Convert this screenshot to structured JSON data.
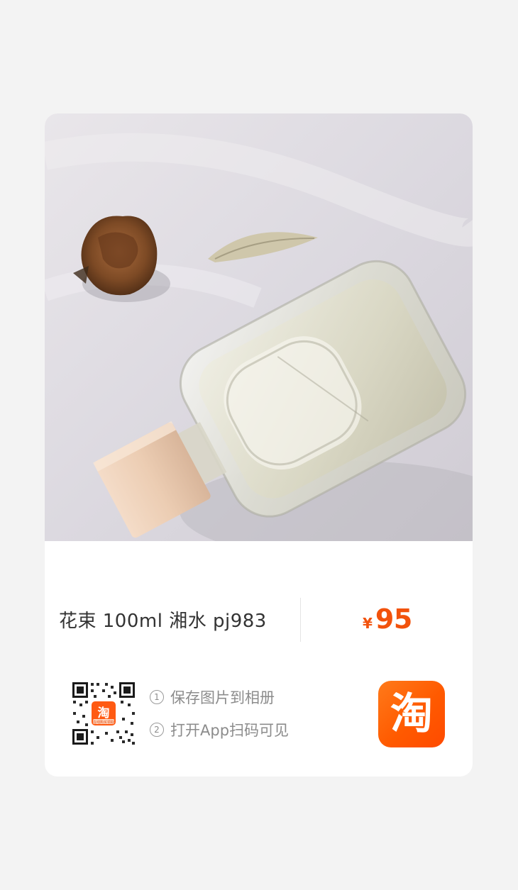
{
  "product": {
    "title": "花束 100ml 湘水 pj983",
    "currency": "¥",
    "price": "95"
  },
  "share": {
    "steps": [
      {
        "num": "1",
        "text": "保存图片到相册"
      },
      {
        "num": "2",
        "text": "打开App扫码可见"
      }
    ],
    "qr_center_logo": "淘",
    "qr_center_caption": "在线购买领取"
  },
  "brand": {
    "logo_text": "淘",
    "accent": "#f2520c"
  }
}
